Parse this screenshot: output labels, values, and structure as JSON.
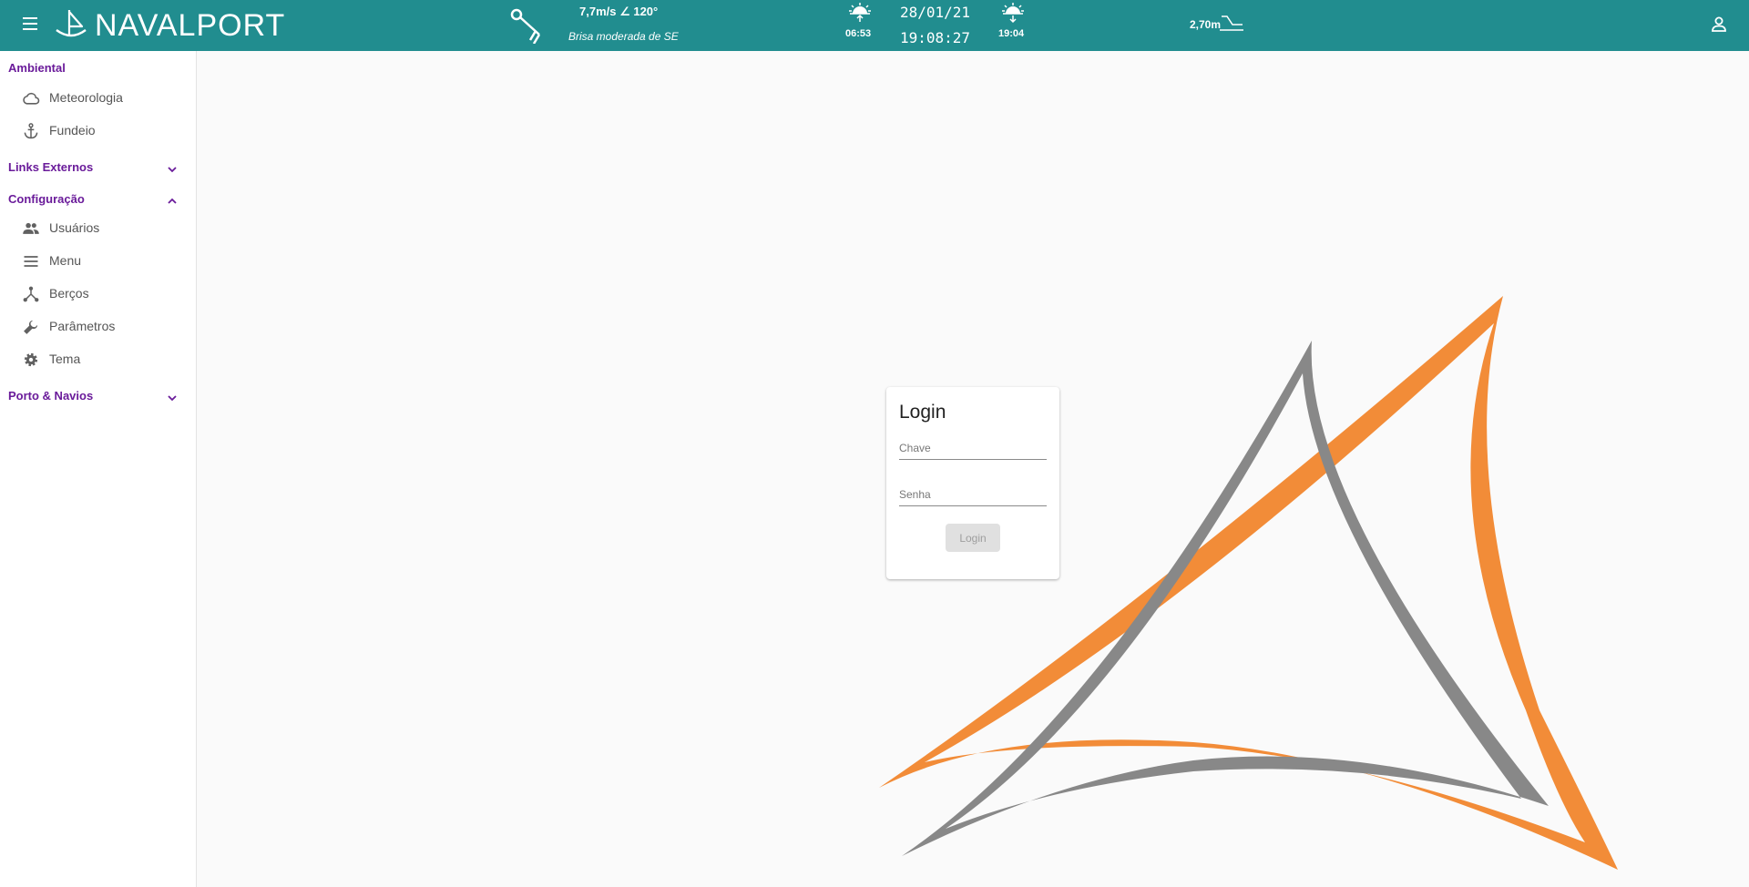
{
  "app": {
    "brand": "NAVALPORT"
  },
  "topbar": {
    "wind_value": "7,7m/s ∠ 120°",
    "wind_description": "Brisa moderada de SE",
    "sunrise_time": "06:53",
    "date": "28/01/21",
    "time": "19:08:27",
    "sunset_time": "19:04",
    "tide_value": "2,70m"
  },
  "sidebar": {
    "ambiental": {
      "label": "Ambiental",
      "items": [
        {
          "label": "Meteorologia",
          "icon": "cloud-icon"
        },
        {
          "label": "Fundeio",
          "icon": "anchor-icon"
        }
      ]
    },
    "links_externos": {
      "label": "Links Externos",
      "expanded": false
    },
    "configuracao": {
      "label": "Configuração",
      "expanded": true,
      "items": [
        {
          "label": "Usuários",
          "icon": "people-icon"
        },
        {
          "label": "Menu",
          "icon": "menu-lines-icon"
        },
        {
          "label": "Berços",
          "icon": "hub-icon"
        },
        {
          "label": "Parâmetros",
          "icon": "wrench-icon"
        },
        {
          "label": "Tema",
          "icon": "gear-icon"
        }
      ]
    },
    "porto_navios": {
      "label": "Porto & Navios",
      "expanded": false
    }
  },
  "login": {
    "title": "Login",
    "key_placeholder": "Chave",
    "password_placeholder": "Senha",
    "button_label": "Login"
  },
  "colors": {
    "header": "#218d8f",
    "section_label": "#6a1b9a",
    "art_orange": "#f28c38",
    "art_gray": "#888888"
  }
}
